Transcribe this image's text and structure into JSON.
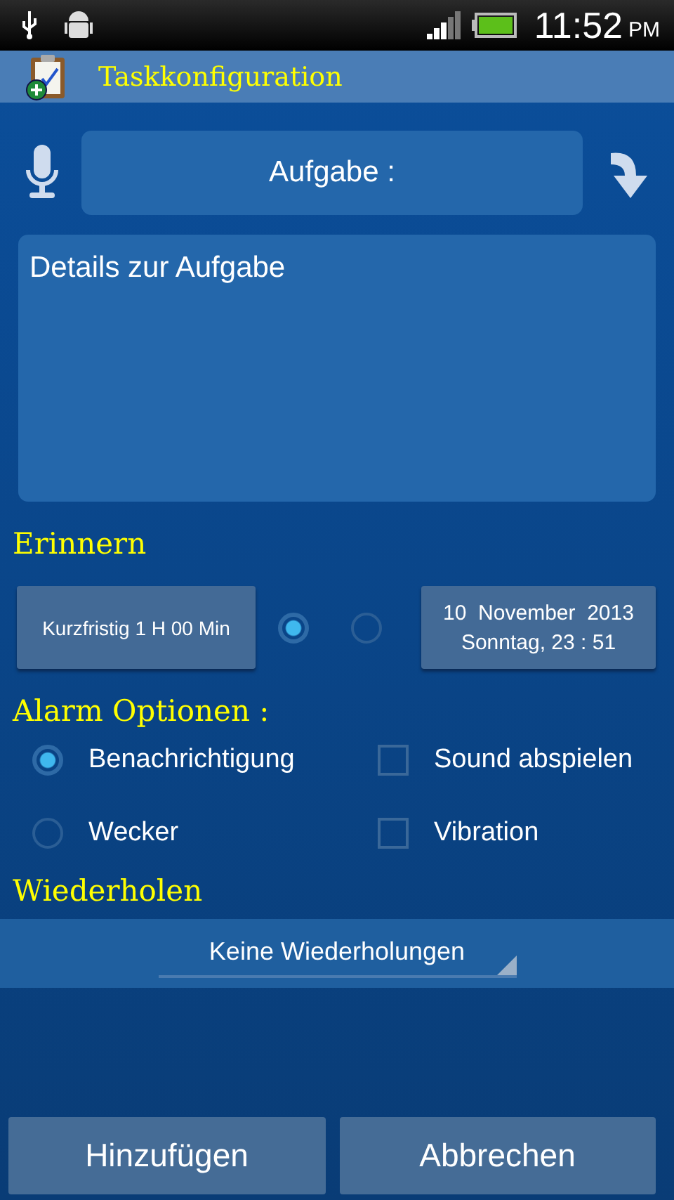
{
  "status_bar": {
    "time": "11:52",
    "ampm": "PM"
  },
  "title_bar": {
    "title": "Taskkonfiguration"
  },
  "task": {
    "placeholder": "Aufgabe :"
  },
  "details": {
    "placeholder": "Details zur Aufgabe"
  },
  "remind": {
    "heading": "Erinnern",
    "short_button": "Kurzfristig 1 H 00 Min",
    "radios": [
      {
        "selected": true
      },
      {
        "selected": false
      }
    ],
    "date_lines": [
      "10  November  2013",
      "Sonntag, 23 : 51"
    ]
  },
  "alarm": {
    "heading": "Alarm Optionen :",
    "options": [
      {
        "kind": "radio",
        "label": "Benachrichtigung",
        "selected": true
      },
      {
        "kind": "checkbox",
        "label": "Sound abspielen",
        "checked": false
      },
      {
        "kind": "radio",
        "label": "Wecker",
        "selected": false
      },
      {
        "kind": "checkbox",
        "label": "Vibration",
        "checked": false
      }
    ]
  },
  "repeat": {
    "heading": "Wiederholen",
    "value": "Keine Wiederholungen"
  },
  "buttons": [
    "Hinzufügen",
    "Abbrechen"
  ]
}
